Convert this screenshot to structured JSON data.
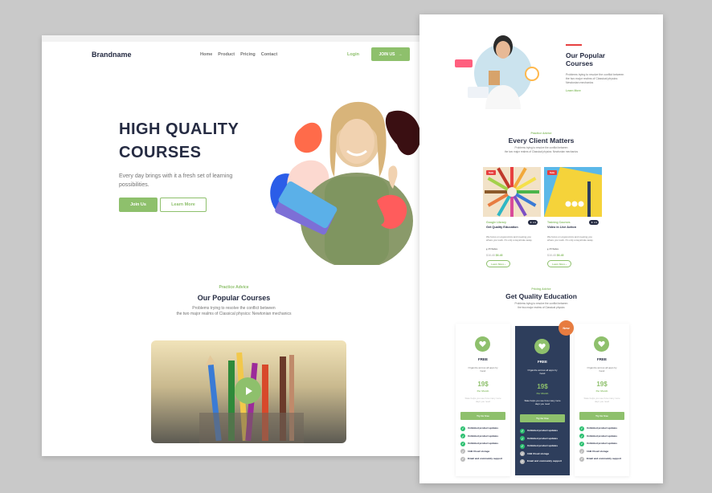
{
  "left": {
    "brand": "Brandname",
    "nav": [
      "Home",
      "Product",
      "Pricing",
      "Contact"
    ],
    "login": "Login",
    "join_label": "JOIN US",
    "hero": {
      "title": "HIGH QUALITY COURSES",
      "text": "Every day brings with it a fresh set of learning possibilities.",
      "btn_primary": "Join Us",
      "btn_secondary": "Learn More"
    },
    "section": {
      "tag": "Practice Advice",
      "title": "Our Popular Courses",
      "desc_line1": "Problems trying to resolve the conflict between",
      "desc_line2": "the two major realms of Classical physics: Newtonian mechanics"
    }
  },
  "right": {
    "top": {
      "title": "Our Popular Courses",
      "desc": "Problems trying to resolve the conflict between the two major realms of Classical physics: Newtonian mechanics",
      "learn": "Learn More"
    },
    "clients": {
      "tag": "Practice Advice",
      "title": "Every Client Matters",
      "desc_line1": "Problems trying to resolve the conflict between",
      "desc_line2": "the two major realms of Classical physics: Newtonian mechanics"
    },
    "cards": [
      {
        "sale": "Sale",
        "category": "Google Library",
        "rating": "4.9",
        "title": "Get Quality Education",
        "text": "We focus on ergonomics and meeting you where you work. It's only a keystroke away.",
        "sales": "15 Sales",
        "old_price": "$16.48",
        "new_price": "$6.48",
        "learn": "Learn More"
      },
      {
        "sale": "Sale",
        "category": "Training Courses",
        "rating": "4.9",
        "title": "Video in Live Action",
        "text": "We focus on ergonomics and meeting you where you work. It's only a keystroke away.",
        "sales": "15 Sales",
        "old_price": "$16.48",
        "new_price": "$6.48",
        "learn": "Learn More"
      }
    ],
    "pricing": {
      "tag": "Pricing Advice",
      "title": "Get Quality Education",
      "desc_line1": "Problems trying to resolve the conflict between",
      "desc_line2": "the two major realms of Classical physics",
      "badge": "New",
      "plans": [
        {
          "name": "FREE",
          "desc": "Organize across all apps by hand",
          "price": "19$",
          "per": "Per Month",
          "note": "Slate helps you see how many more days you need",
          "cta": "Try for free",
          "features": [
            "Unlimited product updates",
            "Unlimited product updates",
            "Unlimited product updates",
            "1GB Cloud storage",
            "Email and community support"
          ]
        },
        {
          "name": "FREE",
          "desc": "Organize across all apps by hand",
          "price": "19$",
          "per": "Per Month",
          "note": "Slate helps you see how many more days you need",
          "cta": "Try for free",
          "features": [
            "Unlimited product updates",
            "Unlimited product updates",
            "Unlimited product updates",
            "1GB Cloud storage",
            "Email and community support"
          ]
        },
        {
          "name": "FREE",
          "desc": "Organize across all apps by hand",
          "price": "19$",
          "per": "Per Month",
          "note": "Slate helps you see how many more days you need",
          "cta": "Try for free",
          "features": [
            "Unlimited product updates",
            "Unlimited product updates",
            "Unlimited product updates",
            "1GB Cloud storage",
            "Email and community support"
          ]
        }
      ]
    }
  },
  "colors": {
    "accent": "#8ec06c",
    "dark": "#252b42",
    "navy": "#2e3e5c",
    "red": "#e74040",
    "orange": "#e77c40",
    "check": "#2dc071"
  }
}
